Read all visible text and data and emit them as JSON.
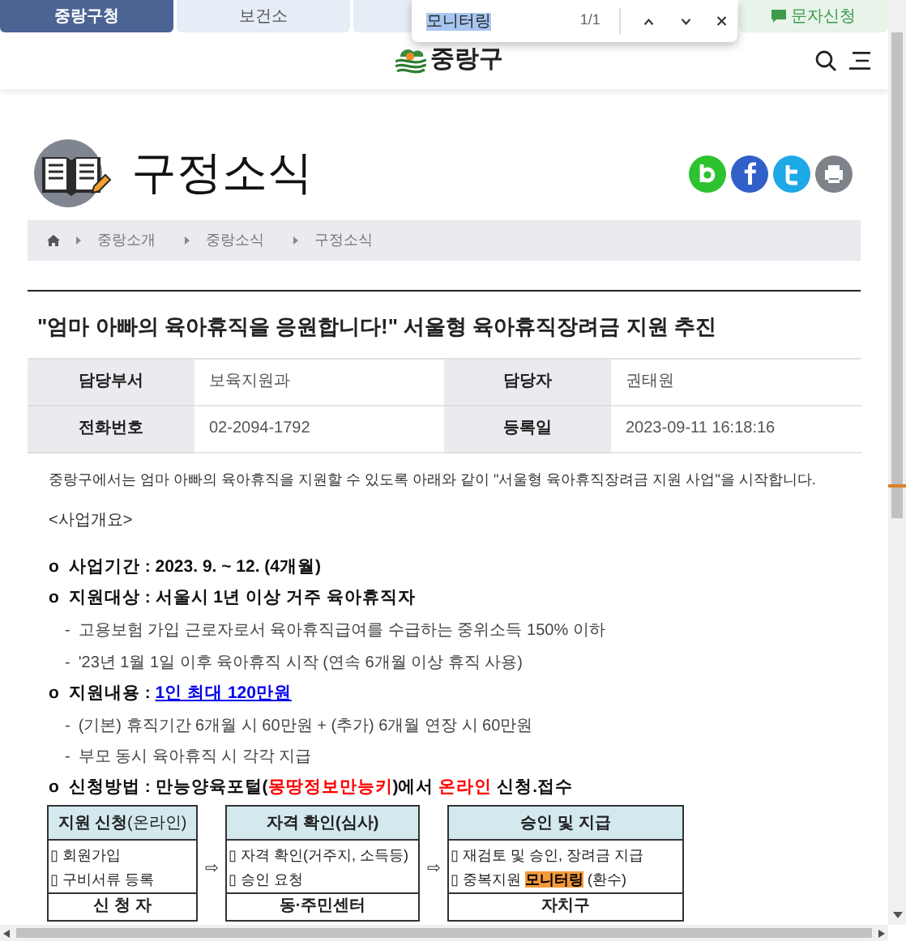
{
  "tabs": [
    {
      "label": "중랑구청",
      "selected": true,
      "kind": "site"
    },
    {
      "label": "보건소",
      "selected": false,
      "kind": "site"
    },
    {
      "label": "문자신청",
      "selected": false,
      "kind": "sms"
    }
  ],
  "find_bar": {
    "query": "모니터링",
    "count": "1/1"
  },
  "header": {
    "logo_text": "중랑구"
  },
  "page_title": "구정소식",
  "breadcrumb": [
    "중랑소개",
    "중랑소식",
    "구정소식"
  ],
  "article": {
    "title": "\"엄마 아빠의 육아휴직을 응원합니다!\" 서울형 육아휴직장려금 지원 추진",
    "info": [
      {
        "label": "담당부서",
        "value": "보육지원과"
      },
      {
        "label": "담당자",
        "value": "권태원"
      },
      {
        "label": "전화번호",
        "value": "02-2094-1792"
      },
      {
        "label": "등록일",
        "value": "2023-09-11 16:18:16"
      }
    ],
    "intro": "중랑구에서는 엄마 아빠의 육아휴직을 지원할 수 있도록 아래와 같이 \"서울형 육아휴직장려금 지원 사업\"을 시작합니다.",
    "section": "<사업개요>",
    "lines": [
      {
        "kind": "bullet",
        "marker": "o",
        "parts": [
          {
            "text": "사업기간 : 2023. 9. ~ 12. (4개월)",
            "kind": "plain"
          }
        ]
      },
      {
        "kind": "bullet",
        "marker": "o",
        "parts": [
          {
            "text": "지원대상 : 서울시 1년 이상 거주 육아휴직자",
            "kind": "plain"
          }
        ]
      },
      {
        "kind": "dash",
        "marker": "-",
        "parts": [
          {
            "text": "고용보험 가입 근로자로서 육아휴직급여를 수급하는 중위소득 150% 이하",
            "kind": "plain"
          }
        ]
      },
      {
        "kind": "dash",
        "marker": "-",
        "parts": [
          {
            "text": "'23년 1월 1일 이후 육아휴직 시작 (연속 6개월 이상 휴직 사용)",
            "kind": "plain"
          }
        ]
      },
      {
        "kind": "bullet",
        "marker": "o",
        "parts": [
          {
            "text": "지원내용 : ",
            "kind": "plain"
          },
          {
            "text": "1인 최대 120만원",
            "kind": "link"
          }
        ]
      },
      {
        "kind": "dash",
        "marker": "-",
        "parts": [
          {
            "text": "(기본) 휴직기간 6개월 시 60만원 + (추가) 6개월 연장 시 60만원",
            "kind": "plain"
          }
        ]
      },
      {
        "kind": "dash",
        "marker": "-",
        "parts": [
          {
            "text": "부모 동시 육아휴직 시 각각 지급",
            "kind": "plain"
          }
        ]
      },
      {
        "kind": "bullet",
        "marker": "o",
        "parts": [
          {
            "text": "신청방법 : 만능양육포털(",
            "kind": "plain"
          },
          {
            "text": "몽땅정보만능키",
            "kind": "red"
          },
          {
            "text": ")에서 ",
            "kind": "plain"
          },
          {
            "text": "온라인",
            "kind": "red"
          },
          {
            "text": " 신청.접수",
            "kind": "plain"
          }
        ]
      }
    ],
    "flow": [
      {
        "title": [
          {
            "text": "지원 신청",
            "kind": "bold"
          },
          {
            "text": "(온라인)",
            "kind": "plain"
          }
        ],
        "items": [
          [
            {
              "text": "▯ 회원가입",
              "highlight": false
            }
          ],
          [
            {
              "text": "▯ 구비서류 등록",
              "highlight": false
            }
          ]
        ],
        "agency": "신 청 자"
      },
      {
        "title": [
          {
            "text": "자격 확인(심사)",
            "kind": "bold"
          }
        ],
        "items": [
          [
            {
              "text": "▯ 자격 확인(거주지, 소득등)",
              "highlight": false
            }
          ],
          [
            {
              "text": "▯ 승인 요청",
              "highlight": false
            }
          ]
        ],
        "agency": "동·주민센터"
      },
      {
        "title": [
          {
            "text": "승인 및 지급",
            "kind": "bold"
          }
        ],
        "items": [
          [
            {
              "text": "▯ 재검토 및 승인, 장려금 지급",
              "highlight": false
            }
          ],
          [
            {
              "text": "▯ 중복지원 ",
              "highlight": false
            },
            {
              "text": "모니터링",
              "highlight": true
            },
            {
              "text": " (환수)",
              "highlight": false
            }
          ]
        ],
        "agency": "자치구"
      }
    ],
    "flow_arrows": [
      "⇨",
      "⇨"
    ]
  }
}
